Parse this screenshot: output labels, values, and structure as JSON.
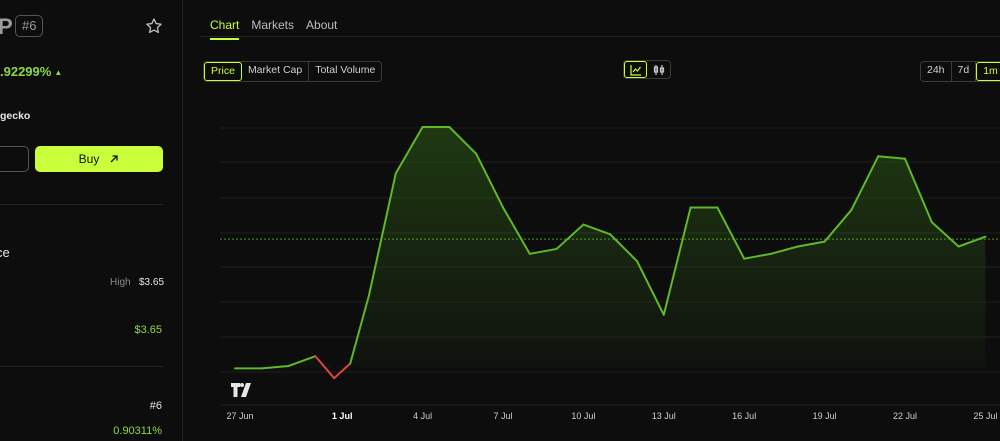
{
  "coin": {
    "symbol_fragment": "P",
    "rank_badge": "#6",
    "change_pct": ".92299%",
    "change_arrow": "▲",
    "source_fragment": "gecko",
    "buy_label": "Buy",
    "section_fragment": "ce",
    "high_label": "High",
    "high_value": "$3.65",
    "price_value": "$3.65",
    "rank_value": "#6",
    "dominance_value": "0.90311%"
  },
  "tabs": [
    {
      "label": "Chart",
      "active": true
    },
    {
      "label": "Markets",
      "active": false
    },
    {
      "label": "About",
      "active": false
    }
  ],
  "metrics": [
    {
      "label": "Price",
      "active": true
    },
    {
      "label": "Market Cap",
      "active": false
    },
    {
      "label": "Total Volume",
      "active": false
    }
  ],
  "chart_types": [
    {
      "icon": "line-chart-icon",
      "active": true
    },
    {
      "icon": "candlestick-icon",
      "active": false
    }
  ],
  "ranges": [
    {
      "label": "24h",
      "active": false
    },
    {
      "label": "7d",
      "active": false
    },
    {
      "label": "1m",
      "active": true
    }
  ],
  "colors": {
    "accent": "#c8ff3a",
    "up": "#5fb827",
    "down": "#e0443e",
    "grid": "#1f1f1f"
  },
  "chart_data": {
    "type": "area",
    "x_tick_labels": [
      "27 Jun",
      "1 Jul",
      "4 Jul",
      "7 Jul",
      "10 Jul",
      "13 Jul",
      "16 Jul",
      "19 Jul",
      "22 Jul",
      "25 Jul"
    ],
    "bold_tick": "1 Jul",
    "x_unit": "days since 27 Jun",
    "points": [
      [
        0,
        2.7
      ],
      [
        1,
        2.7
      ],
      [
        2,
        2.71
      ],
      [
        3,
        2.75
      ],
      [
        3.7,
        2.66
      ],
      [
        4.3,
        2.72
      ],
      [
        5,
        3.0
      ],
      [
        6,
        3.5
      ],
      [
        7,
        3.69
      ],
      [
        8,
        3.69
      ],
      [
        9,
        3.58
      ],
      [
        10,
        3.36
      ],
      [
        11,
        3.17
      ],
      [
        12,
        3.19
      ],
      [
        13,
        3.29
      ],
      [
        14,
        3.25
      ],
      [
        15,
        3.14
      ],
      [
        16,
        2.92
      ],
      [
        17,
        3.36
      ],
      [
        18,
        3.36
      ],
      [
        19,
        3.15
      ],
      [
        20,
        3.17
      ],
      [
        21,
        3.2
      ],
      [
        22,
        3.22
      ],
      [
        23,
        3.35
      ],
      [
        24,
        3.57
      ],
      [
        25,
        3.56
      ],
      [
        26,
        3.3
      ],
      [
        27,
        3.2
      ],
      [
        28,
        3.24
      ]
    ],
    "reference_value": 3.23,
    "ylim": [
      2.55,
      3.85
    ],
    "grid": true
  }
}
